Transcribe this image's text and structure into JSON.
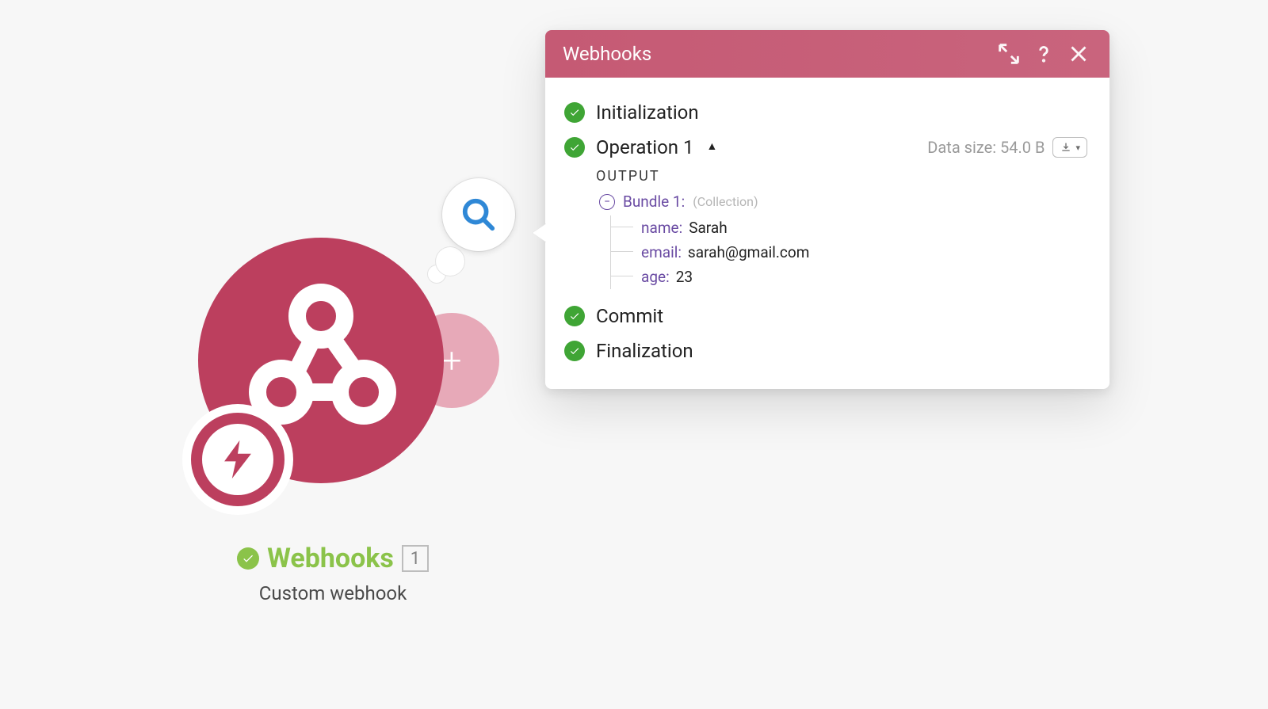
{
  "module": {
    "title": "Webhooks",
    "subtitle": "Custom webhook",
    "count": "1"
  },
  "panel": {
    "title": "Webhooks",
    "steps": {
      "initialization": "Initialization",
      "operation": "Operation 1",
      "commit": "Commit",
      "finalization": "Finalization"
    },
    "data_size_label": "Data size:",
    "data_size_value": "54.0 B",
    "output_heading": "OUTPUT",
    "bundle": {
      "label": "Bundle 1:",
      "type": "(Collection)",
      "fields": [
        {
          "key": "name",
          "value": "Sarah"
        },
        {
          "key": "email",
          "value": "sarah@gmail.com"
        },
        {
          "key": "age",
          "value": "23"
        }
      ]
    }
  }
}
